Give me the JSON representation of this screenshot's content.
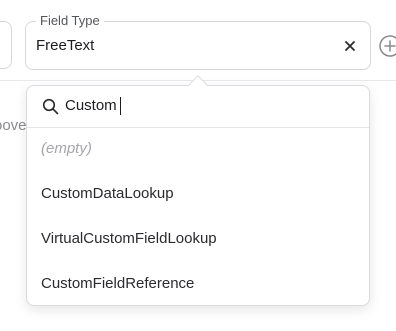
{
  "field": {
    "legend": "Field Type",
    "value": "FreeText"
  },
  "background": {
    "text_fragment": "oove"
  },
  "dropdown": {
    "search_value": "Custom",
    "options": [
      "(empty)",
      "CustomDataLookup",
      "VirtualCustomFieldLookup",
      "CustomFieldReference"
    ]
  },
  "icons": {
    "clear": "close-icon",
    "add": "plus-circle-icon",
    "search": "search-icon"
  },
  "colors": {
    "border": "#d7d7db",
    "text": "#1d1d21",
    "muted": "#a5a5ab"
  }
}
